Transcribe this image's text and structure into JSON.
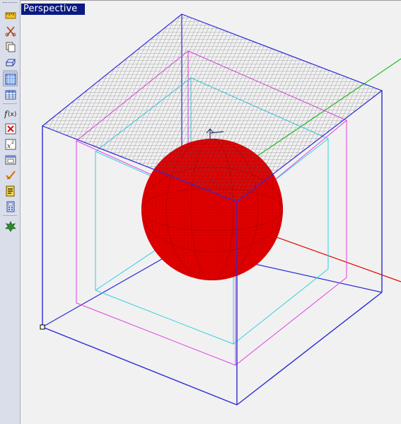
{
  "viewport": {
    "label": "Perspective"
  },
  "toolbar": {
    "tools": [
      {
        "name": "ruler-icon"
      },
      {
        "name": "cut-icon"
      },
      {
        "name": "copy-icon"
      },
      {
        "name": "extrude-icon"
      },
      {
        "name": "grid-icon"
      },
      {
        "name": "table-grid-icon"
      },
      {
        "name": "function-icon"
      },
      {
        "name": "delete-x-icon"
      },
      {
        "name": "exponent-icon"
      },
      {
        "name": "dialog-icon"
      },
      {
        "name": "check-icon"
      },
      {
        "name": "script-icon"
      },
      {
        "name": "calculator-icon"
      },
      {
        "name": "star-icon"
      }
    ]
  },
  "colors": {
    "box": "#2a2ad8",
    "mesh": "#555566",
    "sphere": "#e00000",
    "magenta": "#e040e0",
    "cyan": "#30d0e0",
    "axis_x": "#e00000",
    "axis_y": "#20c020",
    "label_bg": "#0a1a82"
  }
}
